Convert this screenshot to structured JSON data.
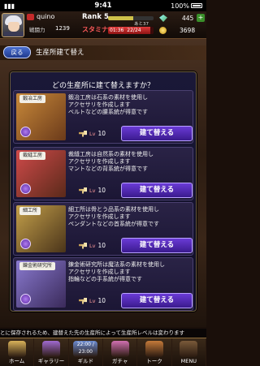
{
  "status_bar": {
    "time": "9:41",
    "battery": "100%"
  },
  "player": {
    "name": "quino",
    "power_label": "戦闘力",
    "power_value": "1239"
  },
  "rank": {
    "label": "Rank 5",
    "next": "あと37",
    "progress": 0.55
  },
  "stamina": {
    "label": "スタミナ",
    "timer": "01:36",
    "value": "22/24",
    "fill": 0.92
  },
  "currency": {
    "gems": "445",
    "coins": "3698"
  },
  "nav": {
    "back_label": "戻る",
    "page_title": "生産所建て替え"
  },
  "dialog": {
    "title": "どの生産所に建て替えますか？"
  },
  "workshops": [
    {
      "name": "鍛冶工房",
      "desc_lines": [
        "鍛冶工房は石系の素材を使用し",
        "アクセサリを作成します",
        "ベルトなどの腰系統が得意です"
      ],
      "cost": "10",
      "button": "建て替える",
      "colors": [
        "#c98a3a",
        "#6b3a1a"
      ]
    },
    {
      "name": "裁縫工房",
      "desc_lines": [
        "裁縫工房は自然系の素材を使用し",
        "アクセサリを作成します",
        "マントなどの背系統が得意です"
      ],
      "cost": "10",
      "button": "建て替える",
      "colors": [
        "#d04a4a",
        "#5a2a1a"
      ]
    },
    {
      "name": "細工所",
      "desc_lines": [
        "細工所は骨とう品系の素材を使用し",
        "アクセサリを作成します",
        "ペンダントなどの首系統が得意です"
      ],
      "cost": "10",
      "button": "建て替える",
      "colors": [
        "#c4a04a",
        "#4a341a"
      ]
    },
    {
      "name": "錬金術研究所",
      "desc_lines": [
        "錬金術研究所は魔法系の素材を使用し",
        "アクセサリを作成します",
        "指輪などの手系統が得意です"
      ],
      "cost": "10",
      "button": "建て替える",
      "colors": [
        "#8a7ad0",
        "#3a2a5a"
      ]
    }
  ],
  "lv_label": "Lv",
  "footer_note": "とに保存されるため、建替えた先の生産所によって生産所レベルは変わります",
  "navbar": [
    {
      "label": "ホーム",
      "color": "#d9b25a"
    },
    {
      "label": "ギャラリー",
      "color": "#a06ad0"
    },
    {
      "label": "ギルド",
      "color": "#6a8ad0",
      "time": "22:00 / 23:00"
    },
    {
      "label": "ガチャ",
      "color": "#d070b0"
    },
    {
      "label": "トーク",
      "color": "#c47a3a"
    },
    {
      "label": "MENU",
      "color": "#7a5a3a"
    }
  ]
}
